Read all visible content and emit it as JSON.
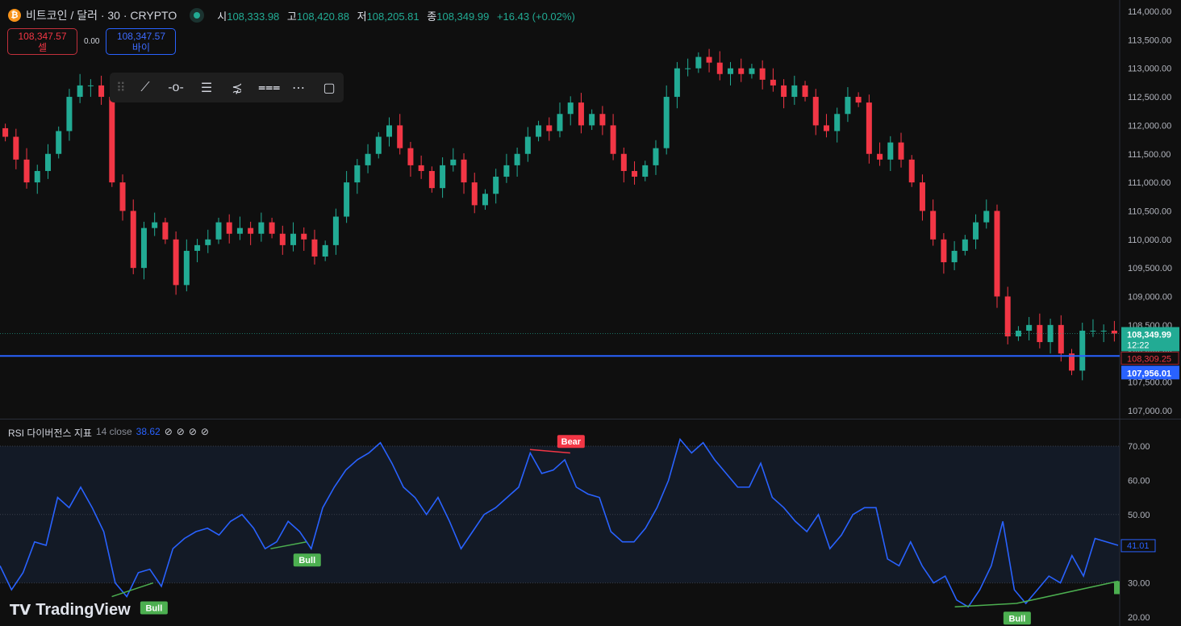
{
  "header": {
    "symbol": "비트코인 / 달러 · 30 · CRYPTO",
    "coin_icon": "bitcoin-icon",
    "o_label": "시",
    "o": "108,333.98",
    "h_label": "고",
    "h": "108,420.88",
    "l_label": "저",
    "l": "108,205.81",
    "c_label": "종",
    "c": "108,349.99",
    "change": "+16.43 (+0.02%)"
  },
  "trade": {
    "sell_price": "108,347.57",
    "sell_label": "셀",
    "spread": "0.00",
    "buy_price": "108,347.57",
    "buy_label": "바이"
  },
  "toolbar": {
    "icons": [
      "drag-handle-icon",
      "trend-line-icon",
      "horizontal-ray-icon",
      "parallel-channel-icon",
      "fib-fan-icon",
      "fib-retracement-icon",
      "pitchfork-icon",
      "rectangle-icon"
    ]
  },
  "rsi_header": {
    "name": "RSI 다이버전스 지표",
    "params": "14 close",
    "value": "38.62",
    "eye_icons": [
      "hidden-icon",
      "hidden-icon",
      "hidden-icon",
      "hidden-icon"
    ]
  },
  "branding": {
    "logo": "TradingView"
  },
  "colors": {
    "up": "#22ab94",
    "down": "#f23645",
    "rsi": "#2962ff",
    "bull": "#4caf50",
    "bear": "#f23645",
    "line": "#2962ff"
  },
  "chart_data": [
    {
      "type": "candlestick",
      "ylim": [
        107000,
        114000
      ],
      "yticks": [
        "114,000.00",
        "113,500.00",
        "113,000.00",
        "112,500.00",
        "112,000.00",
        "111,500.00",
        "111,000.00",
        "110,500.00",
        "110,000.00",
        "109,500.00",
        "109,000.00",
        "108,500.00",
        "108,000.00",
        "107,500.00",
        "107,000.00"
      ],
      "closes": [
        111800,
        111400,
        111000,
        111200,
        111500,
        111900,
        112500,
        112700,
        112700,
        112500,
        111000,
        110500,
        109500,
        110200,
        110300,
        110000,
        109200,
        109800,
        109900,
        110000,
        110300,
        110100,
        110200,
        110100,
        110300,
        110100,
        109900,
        110100,
        110000,
        109700,
        109900,
        110400,
        111000,
        111300,
        111500,
        111800,
        112000,
        111600,
        111300,
        111200,
        110900,
        111300,
        111400,
        111000,
        110600,
        110800,
        111100,
        111300,
        111500,
        111800,
        112000,
        111900,
        112200,
        112400,
        112000,
        112200,
        112000,
        111500,
        111200,
        111100,
        111300,
        111600,
        112500,
        113000,
        113000,
        113200,
        113100,
        112900,
        113000,
        112900,
        113000,
        112800,
        112700,
        112500,
        112700,
        112500,
        112000,
        111900,
        112200,
        112500,
        112400,
        111500,
        111400,
        111700,
        111400,
        111000,
        110500,
        110000,
        109600,
        109800,
        110000,
        110300,
        110500,
        109000,
        108300,
        108400,
        108500,
        108200,
        108500,
        108000,
        107700,
        108400,
        108400,
        108400,
        108350
      ],
      "last_price": "108,349.99",
      "countdown": "12:22",
      "prev_close": "108,309.25",
      "hline_price": 107956.01,
      "hline_label": "107,956.01"
    },
    {
      "type": "line",
      "name": "RSI",
      "ylim": [
        20,
        75
      ],
      "yticks": [
        "70.00",
        "60.00",
        "50.00",
        "40.00",
        "30.00",
        "20.00"
      ],
      "band": [
        30,
        70
      ],
      "values": [
        35,
        28,
        33,
        42,
        41,
        55,
        52,
        58,
        52,
        45,
        30,
        26,
        33,
        34,
        29,
        40,
        43,
        45,
        46,
        44,
        48,
        50,
        46,
        40,
        42,
        48,
        45,
        40,
        52,
        58,
        63,
        66,
        68,
        71,
        65,
        58,
        55,
        50,
        55,
        48,
        40,
        45,
        50,
        52,
        55,
        58,
        68,
        62,
        63,
        66,
        58,
        56,
        55,
        45,
        42,
        42,
        46,
        52,
        60,
        72,
        68,
        71,
        66,
        62,
        58,
        58,
        65,
        55,
        52,
        48,
        45,
        50,
        40,
        44,
        50,
        52,
        52,
        37,
        35,
        42,
        35,
        30,
        32,
        25,
        23,
        28,
        35,
        48,
        28,
        24,
        28,
        32,
        30,
        38,
        32,
        43,
        42,
        41
      ],
      "last_label": "41.01",
      "divergences": [
        {
          "label": "Bull",
          "type": "bull",
          "from": [
            0.1,
            26
          ],
          "to": [
            0.137,
            30
          ]
        },
        {
          "label": "Bull",
          "type": "bull",
          "from": [
            0.242,
            40
          ],
          "to": [
            0.274,
            42
          ]
        },
        {
          "label": "Bear",
          "type": "bear",
          "from": [
            0.474,
            69
          ],
          "to": [
            0.51,
            68
          ]
        },
        {
          "label": "Bull",
          "type": "bull",
          "from": [
            0.854,
            23
          ],
          "to": [
            0.909,
            24
          ]
        }
      ],
      "trend_line": {
        "from": [
          0.909,
          24
        ],
        "to": [
          1.0,
          30.5
        ]
      }
    }
  ]
}
